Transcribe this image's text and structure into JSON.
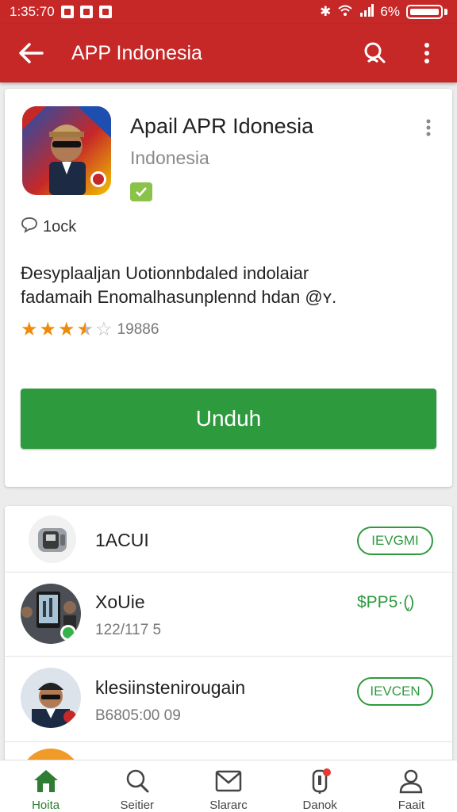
{
  "status_bar": {
    "time": "1:35:70",
    "battery": "6%"
  },
  "app_bar": {
    "title": "APP Indonesia",
    "icons": [
      "arrow-back-icon",
      "search-icon",
      "more-vert-icon"
    ]
  },
  "app": {
    "name": "Apail APR Idonesia",
    "developer": "Indonesia",
    "meta_label": "1ock",
    "description_line1": "Đesyplaaljan Uotionnbdaled indolaiar",
    "description_line2": "fadamaih Enomalhasunplennd hdan @ʏ.",
    "rating": 3.5,
    "rating_count": "19886",
    "install_label": "Unduh"
  },
  "list": [
    {
      "name": "1ACUI",
      "sub": "",
      "action": "IEVGMI",
      "action_type": "pill"
    },
    {
      "name": "XoUie",
      "sub": "122/117 5",
      "action": "$PP5·(̨)",
      "action_type": "price"
    },
    {
      "name": "klesiinstenirougain",
      "sub": "B6805:00 09",
      "action": "IEVCEN",
      "action_type": "pill"
    }
  ],
  "bottom_nav": [
    {
      "label": "Hoita",
      "icon": "home-icon",
      "active": true
    },
    {
      "label": "Seitier",
      "icon": "search-icon",
      "active": false
    },
    {
      "label": "Slararc",
      "icon": "mail-icon",
      "active": false
    },
    {
      "label": "Danok",
      "icon": "notification-icon",
      "active": false
    },
    {
      "label": "Faait",
      "icon": "person-icon",
      "active": false
    }
  ],
  "colors": {
    "primary": "#c62828",
    "accent": "#2e9a3e",
    "star": "#ef8a0c"
  }
}
